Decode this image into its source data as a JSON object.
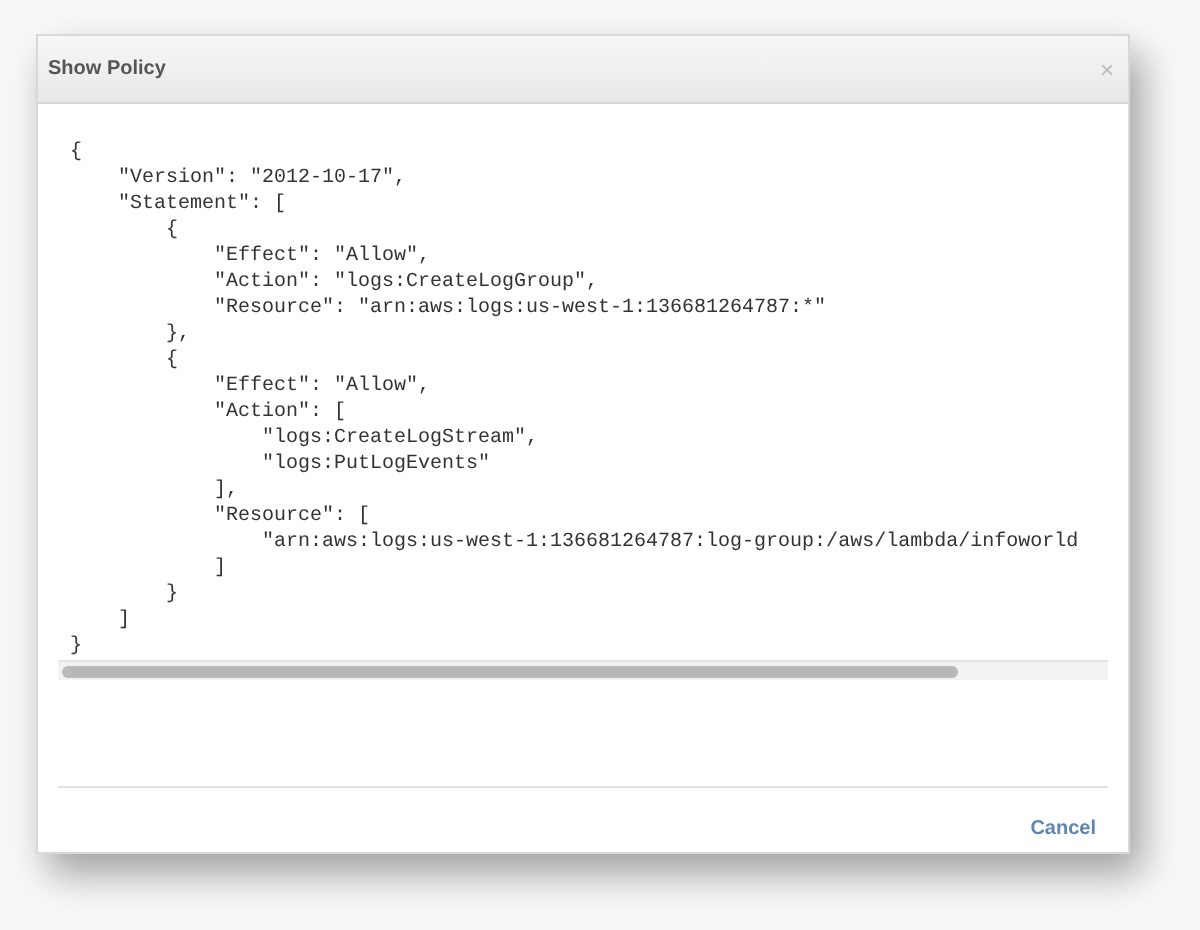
{
  "dialog": {
    "title": "Show Policy",
    "close": "×",
    "code_lines": [
      "{",
      "    \"Version\": \"2012-10-17\",",
      "    \"Statement\": [",
      "        {",
      "            \"Effect\": \"Allow\",",
      "            \"Action\": \"logs:CreateLogGroup\",",
      "            \"Resource\": \"arn:aws:logs:us-west-1:136681264787:*\"",
      "        },",
      "        {",
      "            \"Effect\": \"Allow\",",
      "            \"Action\": [",
      "                \"logs:CreateLogStream\",",
      "                \"logs:PutLogEvents\"",
      "            ],",
      "            \"Resource\": [",
      "                \"arn:aws:logs:us-west-1:136681264787:log-group:/aws/lambda/infoworld",
      "            ]",
      "        }",
      "    ]",
      "}"
    ],
    "buttons": [
      "Cancel"
    ]
  }
}
